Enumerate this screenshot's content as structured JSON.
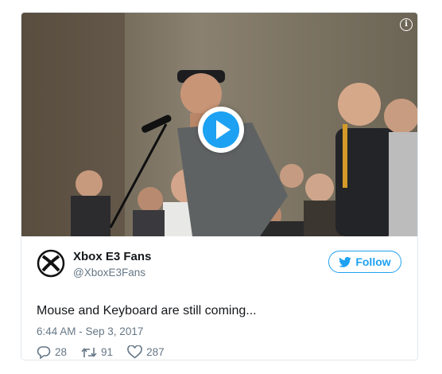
{
  "tweet": {
    "author_name": "Xbox E3 Fans",
    "author_handle": "@XboxE3Fans",
    "follow_label": "Follow",
    "text": "Mouse and Keyboard are still coming...",
    "timestamp": "6:44 AM - Sep 3, 2017",
    "replies": "28",
    "retweets": "91",
    "likes": "287"
  },
  "media": {
    "info_glyph": "i",
    "play_icon": "play-icon"
  },
  "colors": {
    "accent": "#1da1f2",
    "muted_text": "#657786",
    "border": "#e1e8ed"
  }
}
